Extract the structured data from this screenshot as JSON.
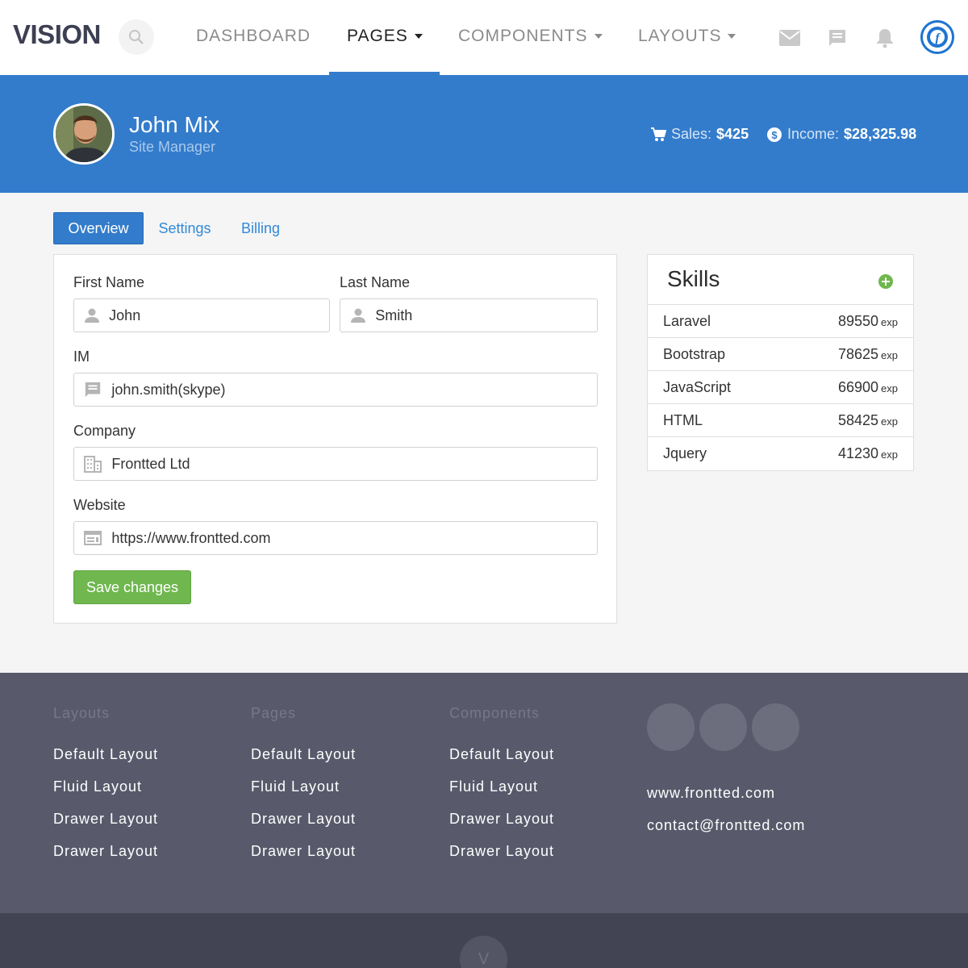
{
  "header": {
    "brand": "VISION",
    "nav": [
      {
        "label": "DASHBOARD",
        "dropdown": false,
        "active": false
      },
      {
        "label": "PAGES",
        "dropdown": true,
        "active": true
      },
      {
        "label": "COMPONENTS",
        "dropdown": true,
        "active": false
      },
      {
        "label": "LAYOUTS",
        "dropdown": true,
        "active": false
      }
    ],
    "icons": [
      "search-icon",
      "mail-icon",
      "chat-icon",
      "bell-icon",
      "user-logo-icon"
    ],
    "logo_letter": "f"
  },
  "profile": {
    "name": "John Mix",
    "role": "Site Manager",
    "sales_label": "Sales:",
    "sales_value": "$425",
    "income_label": "Income:",
    "income_value": "$28,325.98"
  },
  "tabs": [
    "Overview",
    "Settings",
    "Billing"
  ],
  "form": {
    "first_name_label": "First Name",
    "first_name_value": "John",
    "last_name_label": "Last Name",
    "last_name_value": "Smith",
    "im_label": "IM",
    "im_value": "john.smith(skype)",
    "company_label": "Company",
    "company_value": "Frontted Ltd",
    "website_label": "Website",
    "website_value": "https://www.frontted.com",
    "save_label": "Save changes"
  },
  "skills": {
    "title": "Skills",
    "unit": "exp",
    "items": [
      {
        "name": "Laravel",
        "value": "89550"
      },
      {
        "name": "Bootstrap",
        "value": "78625"
      },
      {
        "name": "JavaScript",
        "value": "66900"
      },
      {
        "name": "HTML",
        "value": "58425"
      },
      {
        "name": "Jquery",
        "value": "41230"
      }
    ]
  },
  "footer": {
    "columns": [
      {
        "heading": "Layouts",
        "links": [
          "Default Layout",
          "Fluid Layout",
          "Drawer Layout",
          "Drawer Layout"
        ]
      },
      {
        "heading": "Pages",
        "links": [
          "Default Layout",
          "Fluid Layout",
          "Drawer Layout",
          "Drawer Layout"
        ]
      },
      {
        "heading": "Components",
        "links": [
          "Default Layout",
          "Fluid Layout",
          "Drawer Layout",
          "Drawer Layout"
        ]
      }
    ],
    "website": "www.frontted.com",
    "email": "contact@frontted.com",
    "bottom_logo": "V"
  },
  "colors": {
    "primary": "#337ccb",
    "success": "#6fb74e",
    "footer": "#585a6b",
    "footer_bottom": "#434453"
  }
}
